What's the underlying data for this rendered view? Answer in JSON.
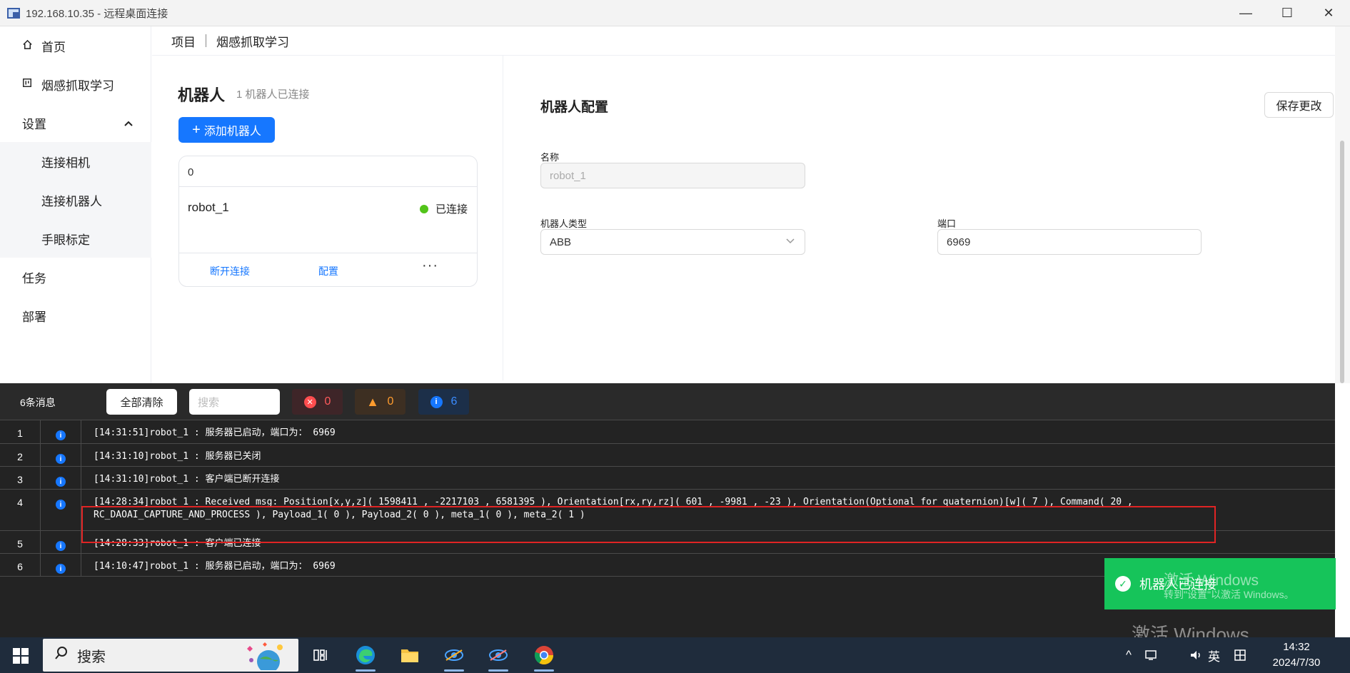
{
  "window": {
    "title": "192.168.10.35 - 远程桌面连接",
    "minimize": "—",
    "maximize": "☐",
    "close": "✕"
  },
  "sidebar": {
    "home": "首页",
    "smoke_learning": "烟感抓取学习",
    "settings": "设置",
    "connect_camera": "连接相机",
    "connect_robot": "连接机器人",
    "hand_eye": "手眼标定",
    "tasks": "任务",
    "deploy": "部署"
  },
  "breadcrumb": {
    "project": "项目",
    "current": "烟感抓取学习"
  },
  "robots": {
    "title": "机器人",
    "count_text": "1 机器人已连接",
    "add_button": "添加机器人",
    "card": {
      "count": "0",
      "name": "robot_1",
      "status": "已连接",
      "status_color": "#52c41a",
      "disconnect": "断开连接",
      "configure": "配置",
      "more": "···"
    }
  },
  "config": {
    "title": "机器人配置",
    "save_button": "保存更改",
    "name_label": "名称",
    "name_placeholder": "robot_1",
    "type_label": "机器人类型",
    "type_value": "ABB",
    "port_label": "端口",
    "port_value": "6969"
  },
  "console": {
    "message_count": "6条消息",
    "clear_all": "全部清除",
    "search_placeholder": "搜索",
    "error_count": "0",
    "warning_count": "0",
    "info_count": "6",
    "rows": [
      {
        "num": "1",
        "text": "[14:31:51]robot_1 : 服务器已启动，端口为： 6969"
      },
      {
        "num": "2",
        "text": "[14:31:10]robot_1 : 服务器已关闭"
      },
      {
        "num": "3",
        "text": "[14:31:10]robot_1 : 客户端已断开连接"
      },
      {
        "num": "4",
        "text": "[14:28:34]robot_1 : Received msg: Position[x,y,z]( 1598411 , -2217103 , 6581395 ), Orientation[rx,ry,rz]( 601 , -9981 , -23 ), Orientation(Optional for quaternion)[w]( 7 ), Command( 20 ,\nRC_DAOAI_CAPTURE_AND_PROCESS ), Payload_1( 0 ), Payload_2( 0 ), meta_1( 0 ), meta_2( 1 )"
      },
      {
        "num": "5",
        "text": "[14:28:33]robot_1 : 客户端已连接"
      },
      {
        "num": "6",
        "text": "[14:10:47]robot_1 : 服务器已启动，端口为： 6969"
      }
    ]
  },
  "toast": {
    "message": "机器人已连接",
    "color": "#16c45a"
  },
  "watermark": {
    "line1": "激活 Windows",
    "line2": "转到\"设置\"以激活 Windows。"
  },
  "taskbar": {
    "search": "搜索",
    "ime": "英",
    "time": "14:32",
    "date": "2024/7/30"
  }
}
